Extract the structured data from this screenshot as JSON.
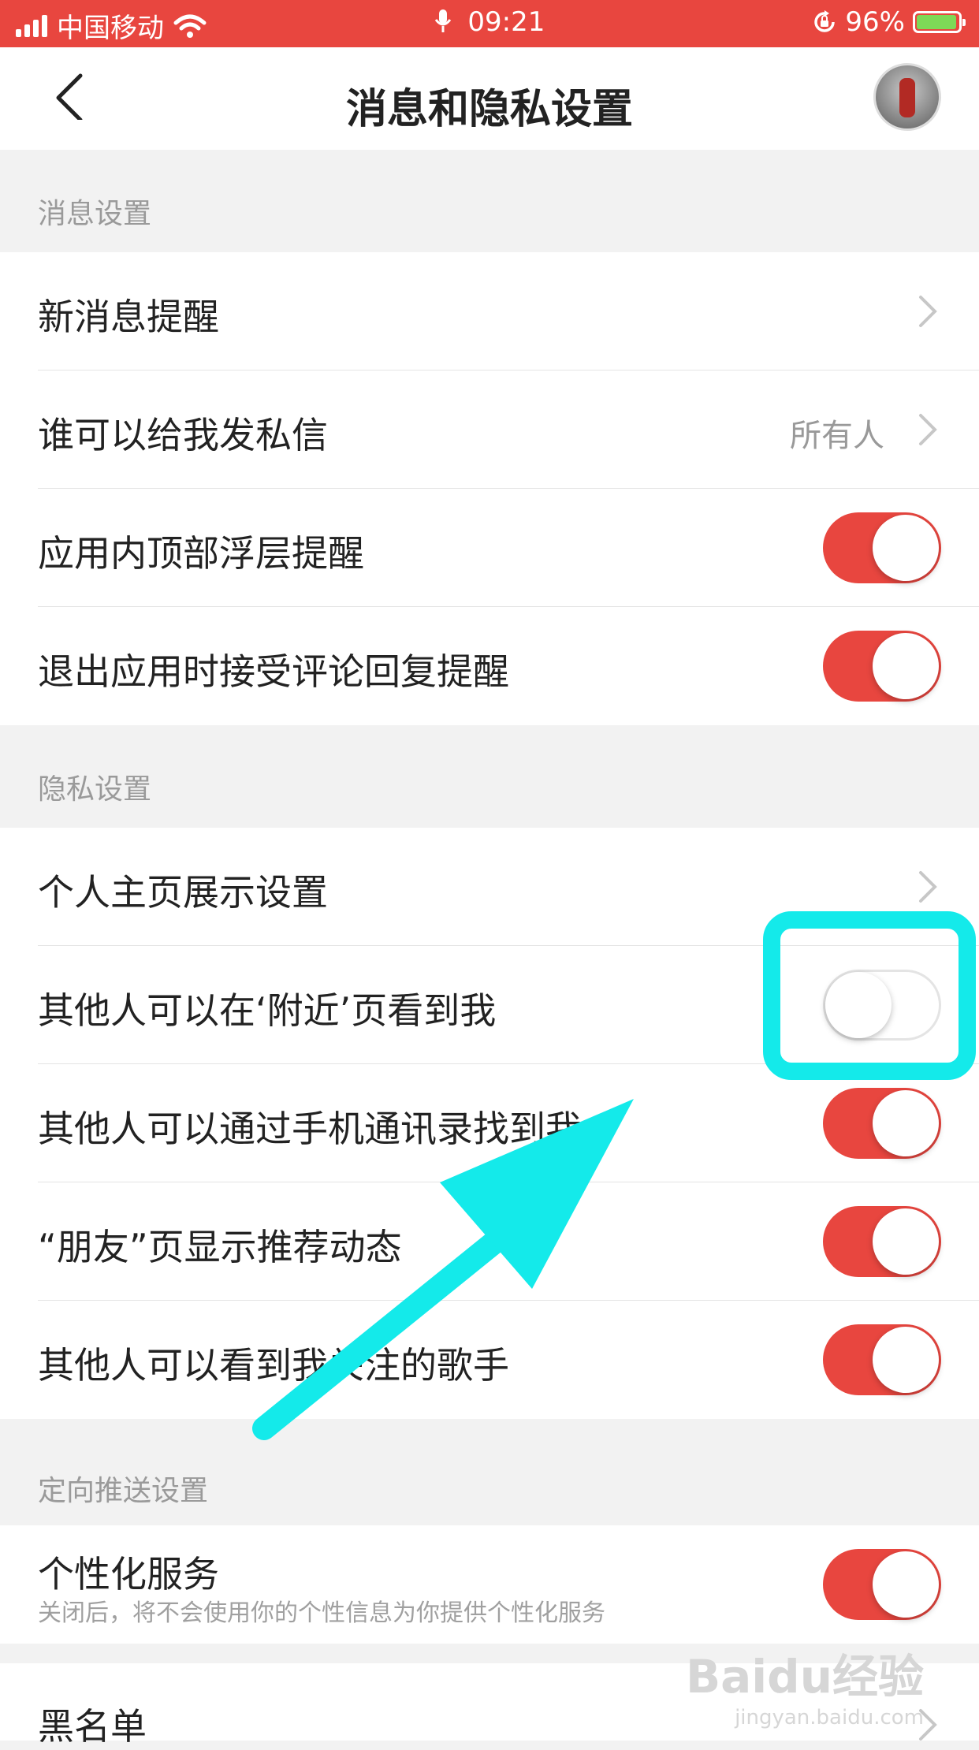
{
  "status_bar": {
    "carrier": "中国移动",
    "time": "09:21",
    "battery": "96%"
  },
  "nav": {
    "title": "消息和隐私设置"
  },
  "sections": {
    "message": {
      "header": "消息设置",
      "rows": [
        {
          "label": "新消息提醒",
          "control": "chevron"
        },
        {
          "label": "谁可以给我发私信",
          "value": "所有人",
          "control": "chevron"
        },
        {
          "label": "应用内顶部浮层提醒",
          "control": "toggle",
          "on": true
        },
        {
          "label": "退出应用时接受评论回复提醒",
          "control": "toggle",
          "on": true
        }
      ]
    },
    "privacy": {
      "header": "隐私设置",
      "rows": [
        {
          "label": "个人主页展示设置",
          "control": "chevron"
        },
        {
          "label": "其他人可以在‘附近’页看到我",
          "control": "toggle",
          "on": false
        },
        {
          "label": "其他人可以通过手机通讯录找到我",
          "control": "toggle",
          "on": true
        },
        {
          "label": "“朋友”页显示推荐动态",
          "control": "toggle",
          "on": true
        },
        {
          "label": "其他人可以看到我关注的歌手",
          "control": "toggle",
          "on": true
        }
      ]
    },
    "push": {
      "header": "定向推送设置",
      "rows": [
        {
          "label": "个性化服务",
          "sublabel": "关闭后，将不会使用你的个性信息为你提供个性化服务",
          "control": "toggle",
          "on": true
        },
        {
          "label": "黑名单",
          "control": "chevron"
        }
      ]
    }
  },
  "watermark": {
    "main": "Baidu经验",
    "sub": "jingyan.baidu.com"
  },
  "colors": {
    "accent": "#e8463f",
    "annotation": "#14eaea",
    "background": "#f2f2f2"
  }
}
